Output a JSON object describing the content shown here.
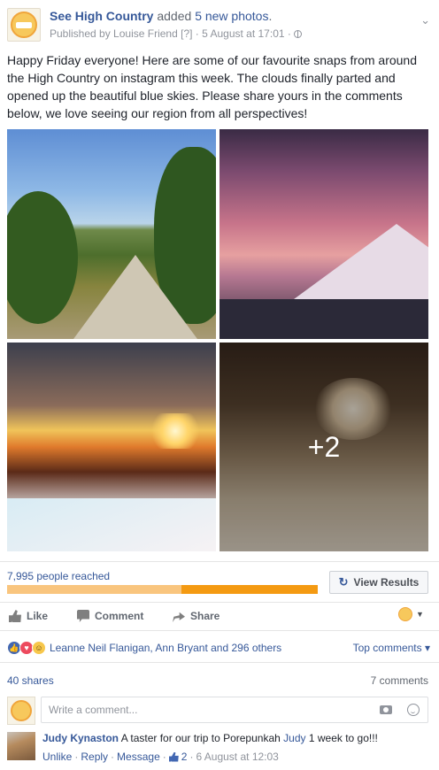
{
  "post": {
    "page_name": "See High Country",
    "action_text": "added",
    "photo_count_text": "5 new photos",
    "period": ".",
    "published_by": "Published by Louise Friend",
    "help_marker": "[?]",
    "timestamp": "· 5 August at 17:01 ·",
    "message": "Happy Friday everyone! Here are some of our favourite snaps from around the High Country on instagram this week. The clouds finally parted and opened up the beautiful blue skies. Please share yours in the comments below, we love seeing our region from all perspectives!",
    "more_photos_label": "+2"
  },
  "reach": {
    "text": "7,995 people reached",
    "organic_fraction": 0.56,
    "view_results_label": "View Results"
  },
  "actions": {
    "like": "Like",
    "comment": "Comment",
    "share": "Share"
  },
  "reactions": {
    "names": "Leanne Neil Flanigan, Ann Bryant and 296 others",
    "top_comments": "Top comments ▾"
  },
  "stats": {
    "shares": "40 shares",
    "comments": "7 comments"
  },
  "composer": {
    "placeholder": "Write a comment..."
  },
  "comment": {
    "author": "Judy Kynaston",
    "text_before": "A taster for our trip to Porepunkah",
    "tagged": "Judy",
    "text_after": "1 week to go!!!",
    "unlike": "Unlike",
    "reply": "Reply",
    "message": "Message",
    "like_count": "2",
    "time": "6 August at 12:03"
  },
  "colors": {
    "link": "#365899",
    "reach_organic": "#f9c57e",
    "reach_paid": "#f49a12"
  }
}
